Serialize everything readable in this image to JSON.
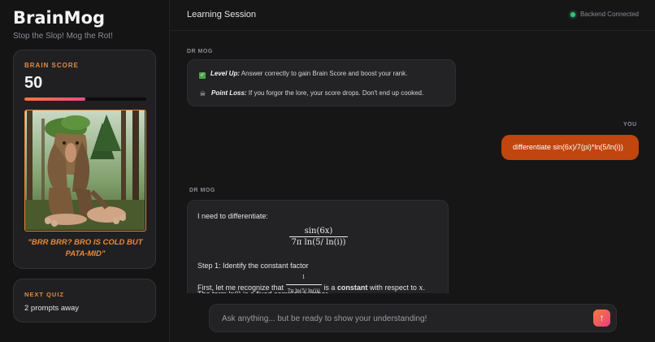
{
  "brand": {
    "title": "BrainMog",
    "tagline": "Stop the Slop! Mog the Rot!"
  },
  "score_card": {
    "label": "BRAIN SCORE",
    "value": "50",
    "progress": 0.5,
    "mascot_icon": "tree-creature-image",
    "caption": "\"BRR BRR? BRO IS COLD BUT PATA-MID\""
  },
  "quiz_card": {
    "label": "NEXT QUIZ",
    "text": "2 prompts away"
  },
  "header": {
    "title": "Learning Session",
    "status": "Backend Connected",
    "status_color": "#2ec27e"
  },
  "chat": {
    "ai_role": "DR MOG",
    "user_role": "YOU",
    "msg1": {
      "line1_icon": "check-icon",
      "line1_bold": "Level Up:",
      "line1_text": " Answer correctly to gain Brain Score and boost your rank.",
      "line2_icon": "skull-icon",
      "line2_bold": "Point Loss:",
      "line2_text": " If you forgor the lore, your score drops. Don't end up cooked."
    },
    "user_msg": "differentiate sin(6x)/7(pi)*ln(5/ln(i))",
    "msg2": {
      "intro": "I need to differentiate:",
      "eq_num": "sin(6x)",
      "eq_den": "7π ln(5/ ln(i))",
      "step1": "Step 1: Identify the constant factor",
      "line_a_pre": "First, let me recognize that ",
      "inline_num": "1",
      "inline_den": "7π ln(5/ ln(i))",
      "line_a_mid": " is a ",
      "line_a_bold": "constant",
      "line_a_post": " with respect to ",
      "line_a_var": "x",
      "line_a_end": ".",
      "line_b": "The term ln(i) is a fixed complex number."
    }
  },
  "composer": {
    "placeholder": "Ask anything... but be ready to show your understanding!",
    "send_icon": "arrow-up-icon"
  },
  "colors": {
    "accent": "#e88a3c",
    "user_bubble": "#c0450f"
  }
}
